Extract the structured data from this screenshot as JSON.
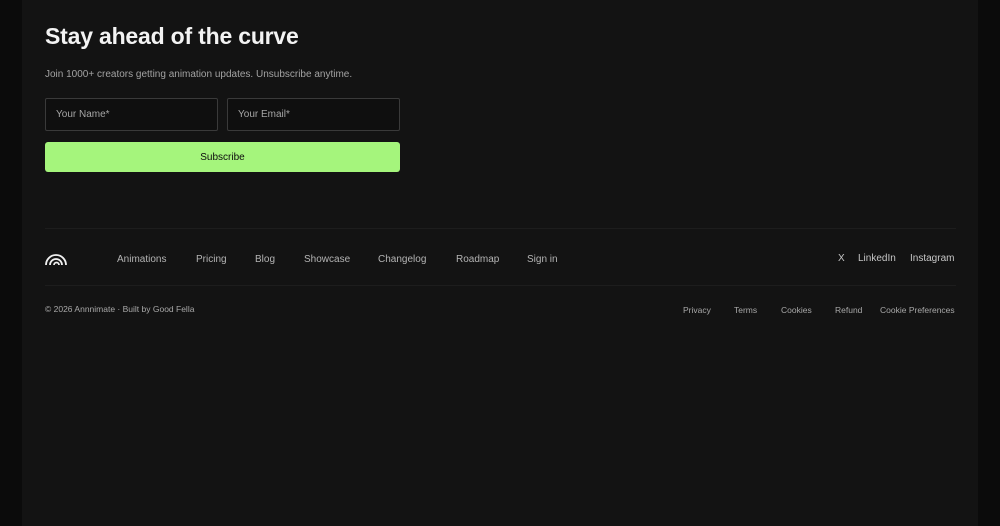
{
  "newsletter": {
    "title": "Stay ahead of the curve",
    "subtitle": "Join 1000+ creators getting animation updates. Unsubscribe anytime.",
    "name_placeholder": "Your Name*",
    "email_placeholder": "Your Email*",
    "subscribe_label": "Subscribe"
  },
  "footer": {
    "logo_icon": "rainbow-arcs-logo-icon",
    "nav": [
      {
        "label": "Animations"
      },
      {
        "label": "Pricing"
      },
      {
        "label": "Blog"
      },
      {
        "label": "Showcase"
      },
      {
        "label": "Changelog"
      },
      {
        "label": "Roadmap"
      },
      {
        "label": "Sign in"
      }
    ],
    "social": [
      {
        "label": "X"
      },
      {
        "label": "LinkedIn"
      },
      {
        "label": "Instagram"
      }
    ],
    "copyright": "© 2026 Annnimate · Built by Good Fella",
    "legal": [
      {
        "label": "Privacy"
      },
      {
        "label": "Terms"
      },
      {
        "label": "Cookies"
      },
      {
        "label": "Refund"
      },
      {
        "label": "Cookie Preferences"
      }
    ]
  },
  "colors": {
    "background": "#131313",
    "accent": "#a5f57c",
    "text_primary": "#f3f3f3",
    "text_muted": "#a3a3a3"
  }
}
